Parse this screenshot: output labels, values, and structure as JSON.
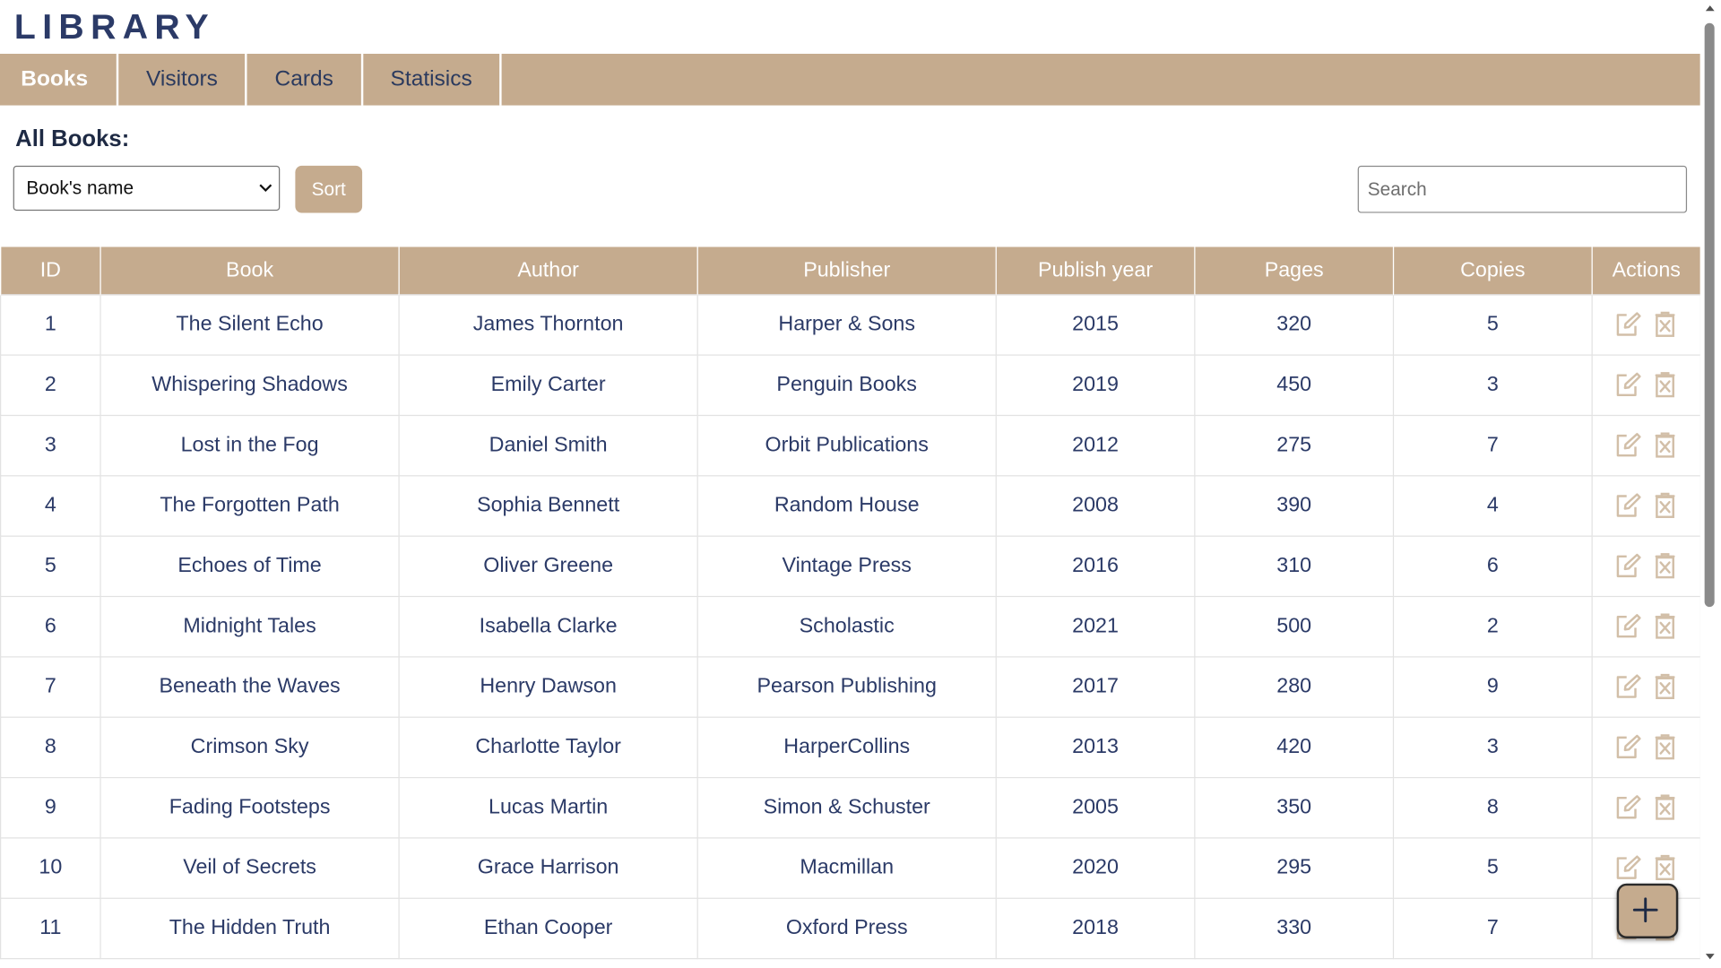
{
  "app": {
    "title": "LIBRARY"
  },
  "nav": {
    "tabs": [
      {
        "label": "Books",
        "active": true
      },
      {
        "label": "Visitors",
        "active": false
      },
      {
        "label": "Cards",
        "active": false
      },
      {
        "label": "Statisics",
        "active": false
      }
    ]
  },
  "section": {
    "title": "All Books:"
  },
  "sort": {
    "selected": "Book's name",
    "button_label": "Sort"
  },
  "search": {
    "placeholder": "Search",
    "value": ""
  },
  "table": {
    "headers": [
      "ID",
      "Book",
      "Author",
      "Publisher",
      "Publish year",
      "Pages",
      "Copies",
      "Actions"
    ],
    "rows": [
      [
        "1",
        "The Silent Echo",
        "James Thornton",
        "Harper & Sons",
        "2015",
        "320",
        "5"
      ],
      [
        "2",
        "Whispering Shadows",
        "Emily Carter",
        "Penguin Books",
        "2019",
        "450",
        "3"
      ],
      [
        "3",
        "Lost in the Fog",
        "Daniel Smith",
        "Orbit Publications",
        "2012",
        "275",
        "7"
      ],
      [
        "4",
        "The Forgotten Path",
        "Sophia Bennett",
        "Random House",
        "2008",
        "390",
        "4"
      ],
      [
        "5",
        "Echoes of Time",
        "Oliver Greene",
        "Vintage Press",
        "2016",
        "310",
        "6"
      ],
      [
        "6",
        "Midnight Tales",
        "Isabella Clarke",
        "Scholastic",
        "2021",
        "500",
        "2"
      ],
      [
        "7",
        "Beneath the Waves",
        "Henry Dawson",
        "Pearson Publishing",
        "2017",
        "280",
        "9"
      ],
      [
        "8",
        "Crimson Sky",
        "Charlotte Taylor",
        "HarperCollins",
        "2013",
        "420",
        "3"
      ],
      [
        "9",
        "Fading Footsteps",
        "Lucas Martin",
        "Simon & Schuster",
        "2005",
        "350",
        "8"
      ],
      [
        "10",
        "Veil of Secrets",
        "Grace Harrison",
        "Macmillan",
        "2020",
        "295",
        "5"
      ],
      [
        "11",
        "The Hidden Truth",
        "Ethan Cooper",
        "Oxford Press",
        "2018",
        "330",
        "7"
      ]
    ],
    "row_action_icons": [
      "edit-icon",
      "delete-icon"
    ]
  },
  "fab": {
    "icon": "plus-icon"
  },
  "colors": {
    "accent": "#c5ab8e",
    "text": "#2b3a67",
    "header_text": "#ffffff",
    "icon": "#d2bfa8"
  }
}
